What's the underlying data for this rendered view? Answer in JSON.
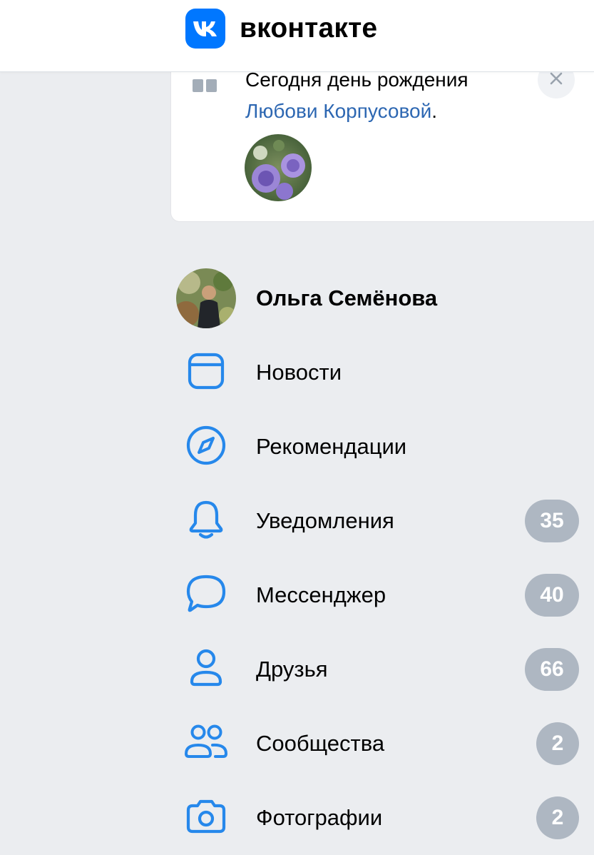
{
  "header": {
    "logo_text": "вконтакте",
    "brand_color": "#0077ff"
  },
  "birthday": {
    "text_prefix": "Сегодня день рождения",
    "person_name": "Любови Корпусовой",
    "text_suffix": ".",
    "icon": "gift-icon",
    "close_icon": "close-icon"
  },
  "menu": {
    "profile_name": "Ольга Семёнова",
    "items": [
      {
        "label": "Новости",
        "icon": "newsfeed-icon",
        "badge": ""
      },
      {
        "label": "Рекомендации",
        "icon": "compass-icon",
        "badge": ""
      },
      {
        "label": "Уведомления",
        "icon": "bell-icon",
        "badge": "35"
      },
      {
        "label": "Мессенджер",
        "icon": "message-icon",
        "badge": "40"
      },
      {
        "label": "Друзья",
        "icon": "user-icon",
        "badge": "66"
      },
      {
        "label": "Сообщества",
        "icon": "users-icon",
        "badge": "2"
      },
      {
        "label": "Фотографии",
        "icon": "camera-icon",
        "badge": "2"
      }
    ],
    "icon_color": "#2688eb",
    "badge_color": "#aeb7c2"
  }
}
